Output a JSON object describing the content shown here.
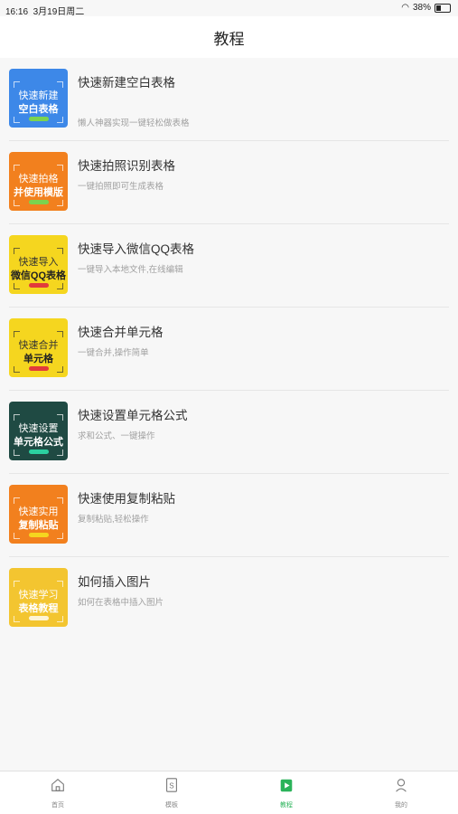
{
  "status_bar": {
    "time": "16:16",
    "date": "3月19日周二",
    "battery": "38%"
  },
  "header": {
    "title": "教程"
  },
  "tutorials": [
    {
      "title": "快速新建空白表格",
      "desc": "懒人神器实现一键轻松做表格",
      "thumb_line1": "快速新建",
      "thumb_line2": "空白表格",
      "bg": "#3d88e8"
    },
    {
      "title": "快速拍照识别表格",
      "desc": "一键拍照即可生成表格",
      "thumb_line1": "快速拍格",
      "thumb_line2": "并使用模版",
      "bg": "#f2801e"
    },
    {
      "title": "快速导入微信QQ表格",
      "desc": "一键导入本地文件,在线编辑",
      "thumb_line1": "快速导入",
      "thumb_line2": "微信QQ表格",
      "bg": "#f5d61f"
    },
    {
      "title": "快速合并单元格",
      "desc": "一键合并,操作简单",
      "thumb_line1": "快速合并",
      "thumb_line2": "单元格",
      "bg": "#f5d61f"
    },
    {
      "title": "快速设置单元格公式",
      "desc": "求和公式、一键操作",
      "thumb_line1": "快速设置",
      "thumb_line2": "单元格公式",
      "bg": "#1f4a43"
    },
    {
      "title": "快速使用复制粘贴",
      "desc": "复制粘贴,轻松操作",
      "thumb_line1": "快速实用",
      "thumb_line2": "复制粘贴",
      "bg": "#f2801e"
    },
    {
      "title": "如何插入图片",
      "desc": "如何在表格中插入图片",
      "thumb_line1": "快速学习",
      "thumb_line2": "表格教程",
      "bg": "#f3c530"
    }
  ],
  "tabbar": [
    {
      "label": "首页",
      "icon": "home-icon"
    },
    {
      "label": "模板",
      "icon": "template-icon"
    },
    {
      "label": "教程",
      "icon": "tutorial-icon",
      "active": true
    },
    {
      "label": "我的",
      "icon": "profile-icon"
    }
  ],
  "colors": {
    "accent": "#2bb35a",
    "divider": "#e6e6e6",
    "text_secondary": "#a0a0a0"
  }
}
